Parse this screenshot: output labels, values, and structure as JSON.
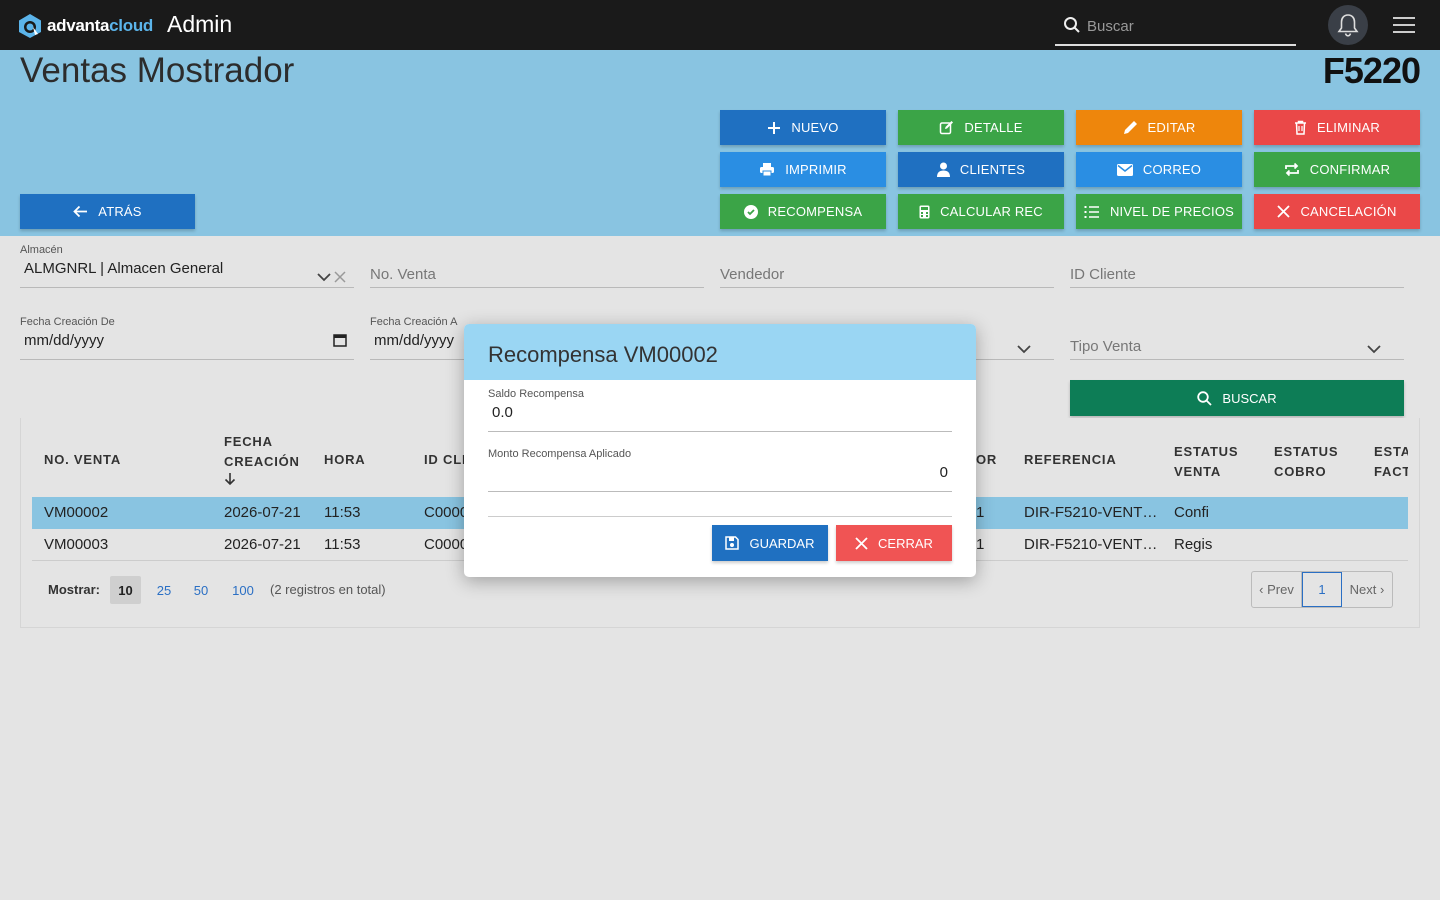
{
  "topbar": {
    "brand_main": "advanta",
    "brand_accent": "cloud",
    "section": "Admin",
    "search_placeholder": "Buscar"
  },
  "header": {
    "title": "Ventas Mostrador",
    "code": "F5220"
  },
  "actions": {
    "nuevo": "NUEVO",
    "detalle": "DETALLE",
    "editar": "EDITAR",
    "eliminar": "ELIMINAR",
    "imprimir": "IMPRIMIR",
    "clientes": "CLIENTES",
    "correo": "CORREO",
    "confirmar": "CONFIRMAR",
    "recompensa": "RECOMPENSA",
    "calcular": "CALCULAR REC",
    "nivel": "NIVEL DE PRECIOS",
    "cancelacion": "CANCELACIÓN",
    "atras": "ATRÁS"
  },
  "filters": {
    "almacen_label": "Almacén",
    "almacen_value": "ALMGNRL | Almacen General",
    "no_venta": "No. Venta",
    "vendedor": "Vendedor",
    "id_cliente": "ID Cliente",
    "fecha_de_label": "Fecha Creación De",
    "fecha_de_value": "mm/dd/yyyy",
    "fecha_a_label": "Fecha Creación A",
    "fecha_a_value": "mm/dd/yyyy",
    "tipo_venta": "Tipo Venta",
    "buscar": "BUSCAR"
  },
  "table": {
    "headers": {
      "no_venta": "NO. VENTA",
      "fecha_1": "FECHA",
      "fecha_2": "CREACIÓN",
      "hora": "HORA",
      "id_cliente": "ID CLI",
      "vendedor": "OR",
      "referencia": "REFERENCIA",
      "estatus_venta_1": "ESTATUS",
      "estatus_venta_2": "VENTA",
      "estatus_cobro_1": "ESTATUS",
      "estatus_cobro_2": "COBRO",
      "estatus_fact_1": "ESTA",
      "estatus_fact_2": "FACT"
    },
    "rows": [
      {
        "no": "VM00002",
        "fecha": "2026-07-21",
        "hora": "11:53",
        "cliente": "C0000",
        "vend": "1",
        "ref": "DIR-F5210-VENT…",
        "estatus": "Confi"
      },
      {
        "no": "VM00003",
        "fecha": "2026-07-21",
        "hora": "11:53",
        "cliente": "C0000",
        "vend": "1",
        "ref": "DIR-F5210-VENT…",
        "estatus": "Regis"
      }
    ]
  },
  "pagination": {
    "mostrar": "Mostrar:",
    "sizes": [
      "10",
      "25",
      "50",
      "100"
    ],
    "total": "(2 registros en total)",
    "prev": "‹ Prev",
    "page": "1",
    "next": "Next ›"
  },
  "modal": {
    "title": "Recompensa VM00002",
    "saldo_label": "Saldo Recompensa",
    "saldo_value": "0.0",
    "monto_label": "Monto Recompensa Aplicado",
    "monto_value": "0",
    "guardar": "GUARDAR",
    "cerrar": "CERRAR"
  },
  "colors": {
    "header_bg": "#89c4e1",
    "modal_header": "#9ad6f3",
    "primary_blue": "#1f70c1",
    "green": "#3ba447",
    "orange": "#ee860c",
    "red": "#ea4848",
    "buscar_green": "#0d7d56"
  }
}
